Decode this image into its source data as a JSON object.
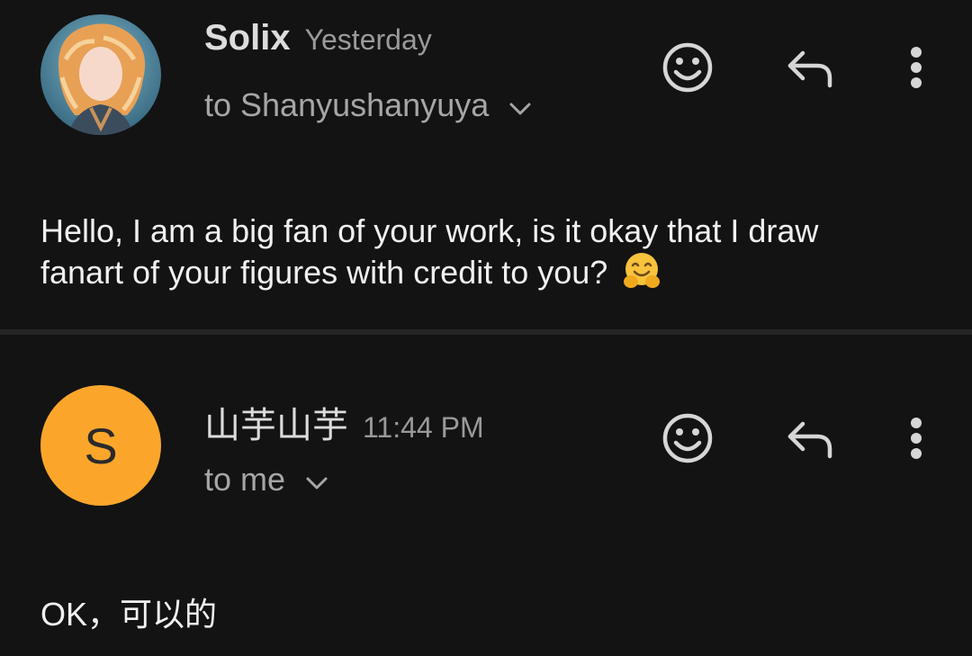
{
  "messages": [
    {
      "sender": "Solix",
      "time": "Yesterday",
      "recipient": "to Shanyushanyuya",
      "avatar": {
        "type": "image",
        "description_icon": "profile-picture"
      },
      "body": "Hello, I am a big fan of your work, is it okay that I draw fanart of your figures with credit to you?",
      "body_emoji": "hugging-face-emoji"
    },
    {
      "sender": "山芋山芋",
      "time": "11:44 PM",
      "recipient": "to me",
      "avatar": {
        "type": "letter",
        "letter": "S",
        "color": "#fba62b"
      },
      "body": "OK，可以的"
    }
  ],
  "icons": {
    "emoji_reaction": "add-emoji-reaction-icon",
    "reply": "reply-arrow-icon",
    "more": "more-vertical-icon",
    "expand": "chevron-down-icon"
  },
  "colors": {
    "background": "#131313",
    "divider": "#252525",
    "avatar_accent": "#fba62b"
  }
}
